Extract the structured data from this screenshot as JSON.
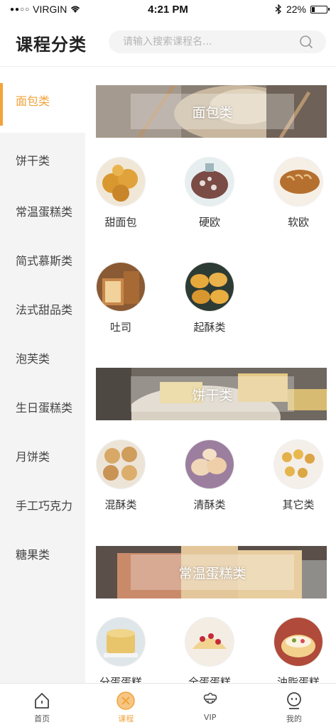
{
  "status_bar": {
    "carrier": "VIRGIN",
    "time": "4:21 PM",
    "battery": "22%",
    "battery_level": 0.22
  },
  "header": {
    "title": "课程分类",
    "search_placeholder": "请输入搜索课程名..."
  },
  "sidebar": {
    "items": [
      {
        "label": "面包类"
      },
      {
        "label": "饼干类"
      },
      {
        "label": "常温蛋糕类"
      },
      {
        "label": "简式慕斯类"
      },
      {
        "label": "法式甜品类"
      },
      {
        "label": "泡芙类"
      },
      {
        "label": "生日蛋糕类"
      },
      {
        "label": "月饼类"
      },
      {
        "label": "手工巧克力"
      },
      {
        "label": "糖果类"
      }
    ],
    "active_index": 0
  },
  "sections": [
    {
      "title": "面包类",
      "items": [
        {
          "label": "甜面包"
        },
        {
          "label": "硬欧"
        },
        {
          "label": "软欧"
        },
        {
          "label": "吐司"
        },
        {
          "label": "起酥类"
        }
      ]
    },
    {
      "title": "饼干类",
      "items": [
        {
          "label": "混酥类"
        },
        {
          "label": "清酥类"
        },
        {
          "label": "其它类"
        }
      ]
    },
    {
      "title": "常温蛋糕类",
      "items": [
        {
          "label": "分蛋蛋糕"
        },
        {
          "label": "全蛋蛋糕"
        },
        {
          "label": "油脂蛋糕"
        }
      ]
    }
  ],
  "tabbar": {
    "tabs": [
      {
        "label": "首页"
      },
      {
        "label": "课程"
      },
      {
        "label": "VIP"
      },
      {
        "label": "我的"
      }
    ],
    "active_index": 1
  },
  "colors": {
    "accent": "#f2a33a",
    "sidebar_bg": "#f4f4f4"
  }
}
